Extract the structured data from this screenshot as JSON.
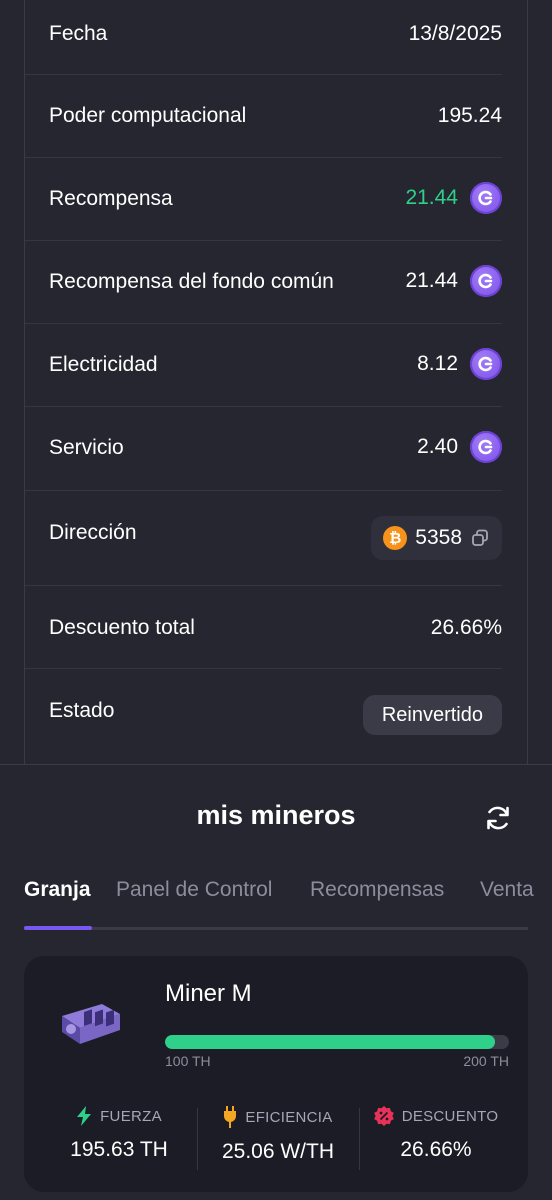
{
  "details": {
    "rows": [
      {
        "label": "Fecha",
        "value": "13/8/2025"
      },
      {
        "label": "Poder computacional",
        "value": "195.24"
      },
      {
        "label": "Recompensa",
        "value": "21.44"
      },
      {
        "label": "Recompensa del fondo común",
        "value": "21.44"
      },
      {
        "label": "Electricidad",
        "value": "8.12"
      },
      {
        "label": "Servicio",
        "value": "2.40"
      },
      {
        "label": "Dirección",
        "value": "5358"
      },
      {
        "label": "Descuento total",
        "value": "26.66%"
      },
      {
        "label": "Estado",
        "value": "Reinvertido"
      }
    ],
    "colors": {
      "reward": "#2fd18a",
      "coin": "#7a4ee8",
      "btc": "#f7931a"
    }
  },
  "section": {
    "title": "mis mineros",
    "refresh_icon": "refresh-icon"
  },
  "tabs": [
    {
      "label": "Granja",
      "active": true
    },
    {
      "label": "Panel de Control",
      "active": false
    },
    {
      "label": "Recompensas",
      "active": false
    },
    {
      "label": "Venta",
      "active": false
    }
  ],
  "miner": {
    "name": "Miner M",
    "range_min": "100 TH",
    "range_max": "200 TH",
    "progress_fraction": 0.96,
    "stats": [
      {
        "label": "FUERZA",
        "value": "195.63 TH",
        "icon": "bolt-icon",
        "color": "#2fd18a"
      },
      {
        "label": "EFICIENCIA",
        "value": "25.06 W/TH",
        "icon": "plug-icon",
        "color": "#f5a623"
      },
      {
        "label": "DESCUENTO",
        "value": "26.66%",
        "icon": "discount-icon",
        "color": "#e8325a"
      }
    ]
  }
}
